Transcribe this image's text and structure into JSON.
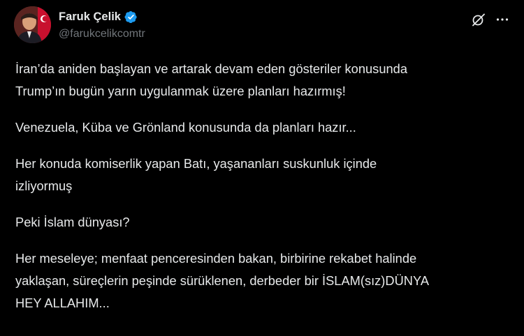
{
  "author": {
    "display_name": "Faruk Çelik",
    "handle": "@farukcelikcomtr",
    "verified": true
  },
  "icons": {
    "verified": "verified-badge-icon",
    "grok": "grok-icon",
    "more": "more-options-icon"
  },
  "colors": {
    "background": "#000000",
    "text": "#e7e9ea",
    "secondary_text": "#71767b",
    "verified_blue": "#1d9bf0"
  },
  "post": {
    "paragraphs": [
      [
        "İran’da aniden başlayan ve artarak devam eden gösteriler konusunda",
        "Trump’ın bugün yarın uygulanmak üzere planları hazırmış!"
      ],
      [
        "Venezuela, Küba ve Grönland konusunda da planları hazır..."
      ],
      [
        "Her konuda komiserlik yapan Batı, yaşananları suskunluk içinde",
        "izliyormuş"
      ],
      [
        "Peki İslam dünyası?"
      ],
      [
        "Her meseleye; menfaat penceresinden bakan, birbirine rekabet halinde",
        "yaklaşan, süreçlerin peşinde sürüklenen, derbeder bir İSLAM(sız)DÜNYA",
        "HEY ALLAHIM..."
      ]
    ]
  }
}
